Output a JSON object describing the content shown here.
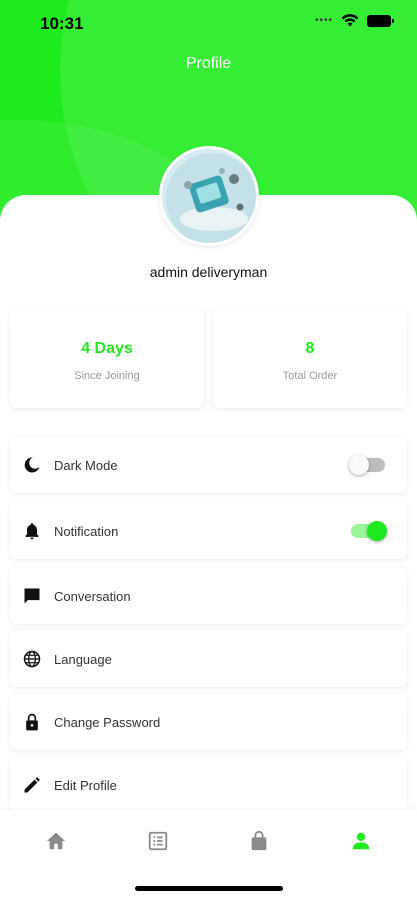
{
  "status_bar": {
    "time": "10:31",
    "signal_icon": "cellular-dots-icon",
    "wifi_icon": "wifi-icon",
    "battery_icon": "battery-icon"
  },
  "header": {
    "title": "Profile",
    "background_color": "#1EEB1E"
  },
  "profile": {
    "name": "admin deliveryman",
    "avatar_icon": "avatar-image"
  },
  "stats": [
    {
      "value": "4 Days",
      "label": "Since Joining"
    },
    {
      "value": "8",
      "label": "Total Order"
    }
  ],
  "menu": {
    "dark_mode": {
      "label": "Dark Mode",
      "icon": "moon-icon",
      "toggle_on": false
    },
    "notification": {
      "label": "Notification",
      "icon": "bell-icon",
      "toggle_on": true
    },
    "conversation": {
      "label": "Conversation",
      "icon": "chat-icon"
    },
    "language": {
      "label": "Language",
      "icon": "globe-icon"
    },
    "change_password": {
      "label": "Change Password",
      "icon": "lock-icon"
    },
    "edit_profile": {
      "label": "Edit Profile",
      "icon": "pencil-icon"
    }
  },
  "bottom_nav": {
    "items": [
      {
        "icon": "home-icon",
        "active": false
      },
      {
        "icon": "list-icon",
        "active": false
      },
      {
        "icon": "bag-icon",
        "active": false
      },
      {
        "icon": "person-icon",
        "active": true
      }
    ],
    "active_color": "#1EEB1E",
    "inactive_color": "#8a8a8a"
  }
}
